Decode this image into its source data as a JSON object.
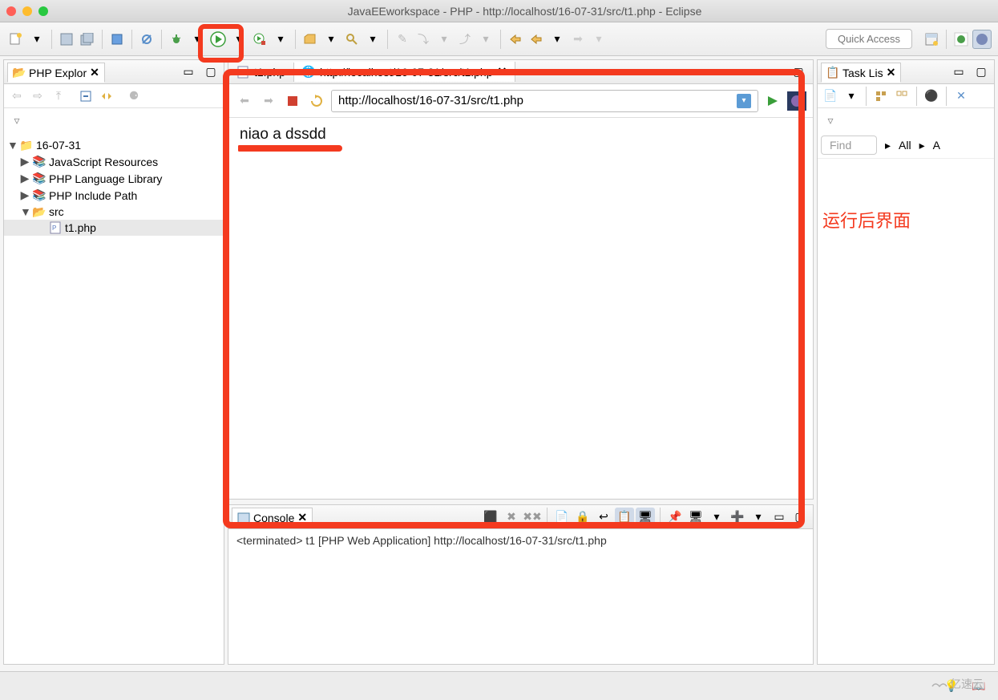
{
  "window": {
    "title": "JavaEEworkspace - PHP - http://localhost/16-07-31/src/t1.php - Eclipse"
  },
  "toolbar": {
    "quick_access": "Quick Access"
  },
  "explorer": {
    "tab_label": "PHP Explor",
    "project": "16-07-31",
    "nodes": {
      "js": "JavaScript Resources",
      "lang": "PHP Language Library",
      "inc": "PHP Include Path",
      "src": "src",
      "file": "t1.php"
    }
  },
  "editor": {
    "tab1": "t1.php",
    "tab2": "http://localhost/16-07-31/src/t1.php"
  },
  "browser": {
    "url": "http://localhost/16-07-31/src/t1.php",
    "output": "niao a dssdd"
  },
  "tasks": {
    "tab_label": "Task Lis",
    "find": "Find",
    "all": "All",
    "a": "A"
  },
  "annotation": "运行后界面",
  "console": {
    "tab_label": "Console",
    "status": "<terminated> t1 [PHP Web Application] http://localhost/16-07-31/src/t1.php"
  },
  "watermark": "亿速云"
}
